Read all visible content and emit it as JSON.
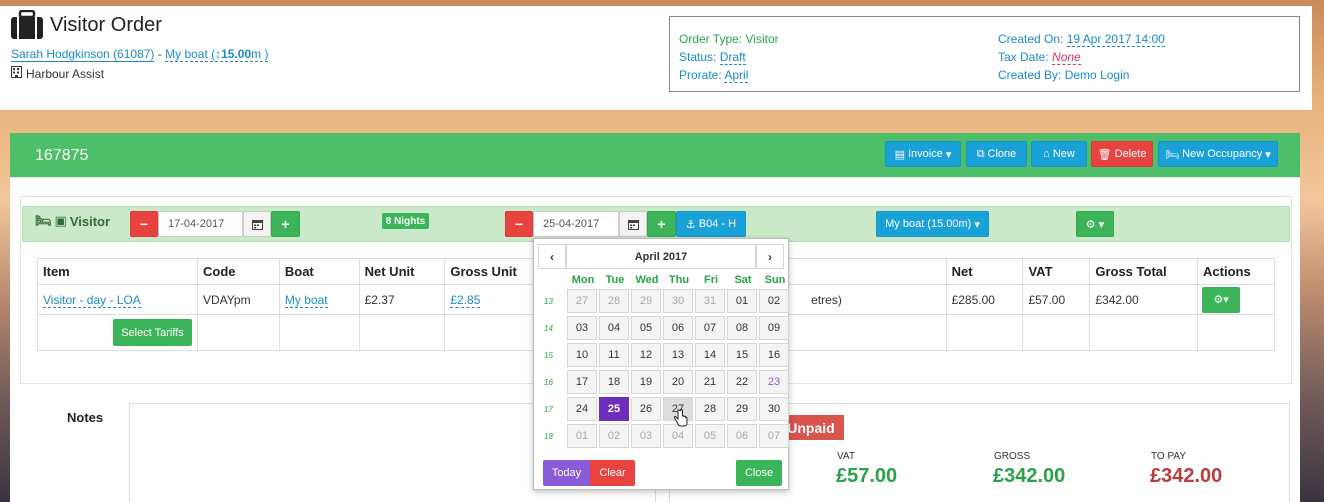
{
  "header": {
    "title": "Visitor Order",
    "customer_link": "Sarah Hodgkinson (61087)",
    "separator": " - ",
    "boat_link_prefix": "My boat (",
    "boat_length": "15.00",
    "boat_link_suffix": "m )",
    "company": "Harbour Assist"
  },
  "info": {
    "order_type_label": "Order Type:",
    "order_type_value": "Visitor",
    "status_label": "Status:",
    "status_value": "Draft",
    "prorate_label": "Prorate:",
    "prorate_value": "April",
    "created_on_label": "Created On:",
    "created_on_value": "19 Apr 2017 14:00",
    "tax_date_label": "Tax Date:",
    "tax_date_value": "None",
    "created_by_label": "Created By:",
    "created_by_value": "Demo Login"
  },
  "panel": {
    "order_number": "167875",
    "buttons": {
      "invoice": "Invoice",
      "clone": "Clone",
      "new": "New",
      "delete": "Delete",
      "new_occupancy": "New Occupancy"
    }
  },
  "visitor": {
    "label": "Visitor",
    "start_date": "17-04-2017",
    "nights": "8 Nights",
    "end_date": "25-04-2017",
    "berth": "B04 - H",
    "boat_select": "My boat (15.00m)"
  },
  "table": {
    "headers": [
      "Item",
      "Code",
      "Boat",
      "Net Unit",
      "Gross Unit",
      "Net",
      "VAT",
      "Gross Total",
      "Actions"
    ],
    "row": {
      "item": "Visitor - day - LOA",
      "code": "VDAYpm",
      "boat": "My boat",
      "net_unit": "£2.37",
      "gross_unit": "£2.85",
      "desc_fragment": "etres)",
      "net": "£285.00",
      "vat": "£57.00",
      "gross_total": "£342.00"
    },
    "select_tariffs": "Select Tariffs"
  },
  "calendar": {
    "month": "April 2017",
    "weekdays": [
      "Mon",
      "Tue",
      "Wed",
      "Thu",
      "Fri",
      "Sat",
      "Sun"
    ],
    "weeks": [
      {
        "wk": "13",
        "days": [
          "27",
          "28",
          "29",
          "30",
          "31",
          "01",
          "02"
        ]
      },
      {
        "wk": "14",
        "days": [
          "03",
          "04",
          "05",
          "06",
          "07",
          "08",
          "09"
        ]
      },
      {
        "wk": "15",
        "days": [
          "10",
          "11",
          "12",
          "13",
          "14",
          "15",
          "16"
        ]
      },
      {
        "wk": "16",
        "days": [
          "17",
          "18",
          "19",
          "20",
          "21",
          "22",
          "23"
        ]
      },
      {
        "wk": "17",
        "days": [
          "24",
          "25",
          "26",
          "27",
          "28",
          "29",
          "30"
        ]
      },
      {
        "wk": "18",
        "days": [
          "01",
          "02",
          "03",
          "04",
          "05",
          "06",
          "07"
        ]
      }
    ],
    "today": "Today",
    "clear": "Clear",
    "close": "Close"
  },
  "notes": {
    "label": "Notes"
  },
  "totals": {
    "status_badge": "Unpaid",
    "vat_label": "VAT",
    "vat_value": "£57.00",
    "gross_label": "GROSS",
    "gross_value": "£342.00",
    "topay_label": "TO PAY",
    "topay_value": "£342.00"
  }
}
